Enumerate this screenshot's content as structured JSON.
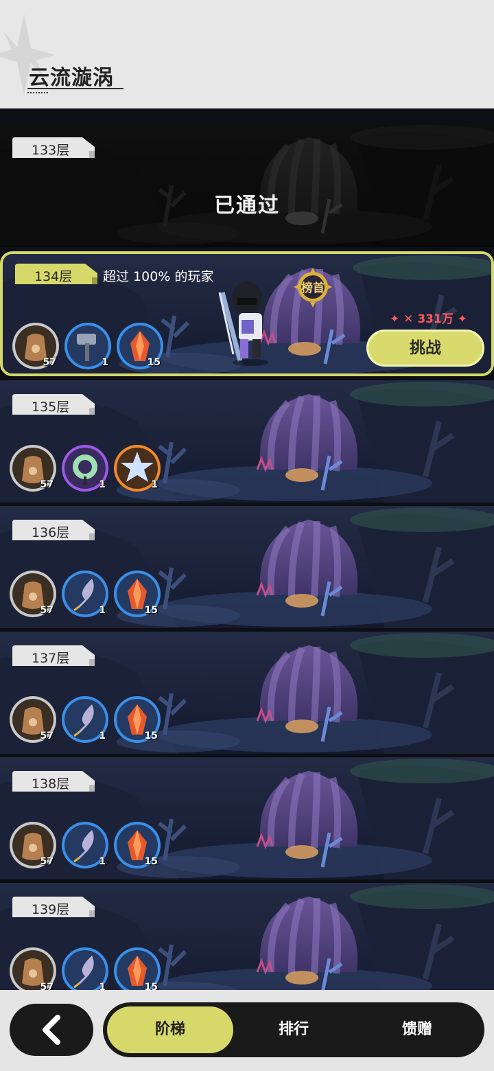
{
  "header": {
    "title": "云流漩涡"
  },
  "floors": [
    {
      "label": "133层",
      "status": "passed",
      "status_text": "已通过"
    },
    {
      "label": "134层",
      "status": "current",
      "beat_text": "超过 100% 的玩家",
      "badge_text": "榜首",
      "power": "331万",
      "challenge_label": "挑战",
      "rewards": [
        {
          "icon": "pouch-icon",
          "qty": "57"
        },
        {
          "icon": "hammer-icon",
          "qty": "1"
        },
        {
          "icon": "red-crystal-icon",
          "qty": "15"
        }
      ]
    },
    {
      "label": "135层",
      "status": "locked",
      "rewards": [
        {
          "icon": "pouch-icon",
          "qty": "57"
        },
        {
          "icon": "jade-ring-icon",
          "qty": "1"
        },
        {
          "icon": "star-crystal-icon",
          "qty": "1"
        }
      ]
    },
    {
      "label": "136层",
      "status": "locked",
      "rewards": [
        {
          "icon": "pouch-icon",
          "qty": "57"
        },
        {
          "icon": "feather-icon",
          "qty": "1"
        },
        {
          "icon": "red-crystal-icon",
          "qty": "15"
        }
      ]
    },
    {
      "label": "137层",
      "status": "locked",
      "rewards": [
        {
          "icon": "pouch-icon",
          "qty": "57"
        },
        {
          "icon": "feather-icon",
          "qty": "1"
        },
        {
          "icon": "red-crystal-icon",
          "qty": "15"
        }
      ]
    },
    {
      "label": "138层",
      "status": "locked",
      "rewards": [
        {
          "icon": "pouch-icon",
          "qty": "57"
        },
        {
          "icon": "feather-icon",
          "qty": "1"
        },
        {
          "icon": "red-crystal-icon",
          "qty": "15"
        }
      ]
    },
    {
      "label": "139层",
      "status": "locked",
      "rewards": [
        {
          "icon": "pouch-icon",
          "qty": "57"
        },
        {
          "icon": "feather-icon",
          "qty": "1"
        },
        {
          "icon": "red-crystal-icon",
          "qty": "15"
        }
      ]
    }
  ],
  "bottom_bar": {
    "tabs": [
      {
        "label": "阶梯",
        "active": true
      },
      {
        "label": "排行",
        "active": false
      },
      {
        "label": "馈赠",
        "active": false
      }
    ]
  },
  "colors": {
    "accent": "#d6d86a",
    "power": "#ff5a5a"
  }
}
